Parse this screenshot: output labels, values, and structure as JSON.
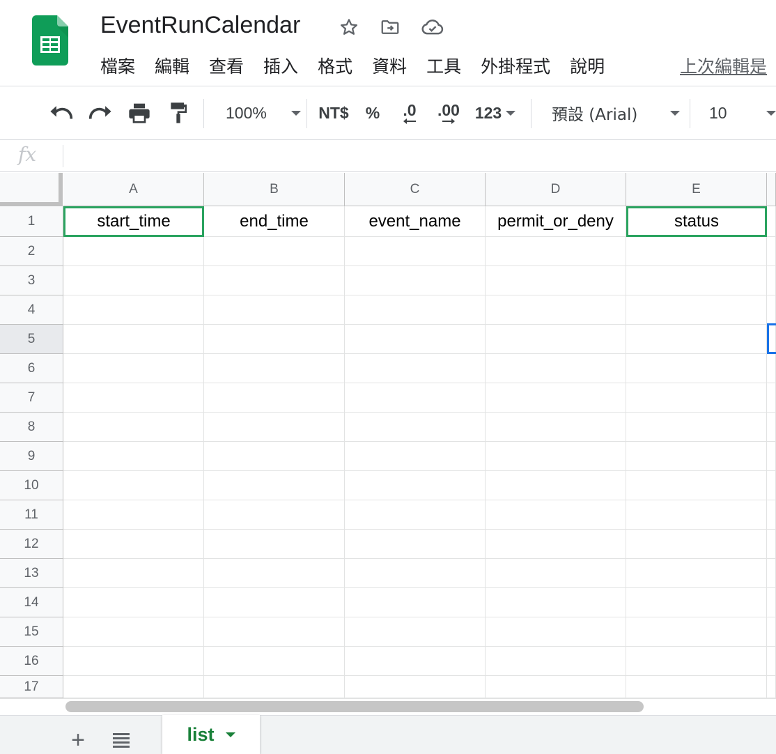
{
  "title": "EventRunCalendar",
  "menu": [
    "檔案",
    "編輯",
    "查看",
    "插入",
    "格式",
    "資料",
    "工具",
    "外掛程式",
    "說明"
  ],
  "last_edit": "上次編輯是",
  "toolbar": {
    "zoom": "100%",
    "currency": "NT$",
    "percent": "%",
    "decrease_decimal": ".0",
    "increase_decimal": ".00",
    "more_formats": "123",
    "font": "預設 (Arial)",
    "font_size": "10"
  },
  "formula_bar": {
    "fx": "fx",
    "value": ""
  },
  "columns": [
    "A",
    "B",
    "C",
    "D",
    "E"
  ],
  "rows": [
    "1",
    "2",
    "3",
    "4",
    "5",
    "6",
    "7",
    "8",
    "9",
    "10",
    "11",
    "12",
    "13",
    "14",
    "15",
    "16",
    "17"
  ],
  "cells": [
    [
      "start_time",
      "end_time",
      "event_name",
      "permit_or_deny",
      "status"
    ]
  ],
  "selection": {
    "active_row": "5",
    "highlighted": [
      "A1",
      "E1"
    ]
  },
  "sheets": [
    {
      "name": "list",
      "active": true
    }
  ],
  "colors": {
    "sheets_green": "#0f9d58",
    "tab_label": "#188038",
    "selection_green": "#2aa35f",
    "active_blue": "#1a73e8"
  },
  "icons": [
    "sheets-logo-icon",
    "star-icon",
    "move-to-folder-icon",
    "cloud-saved-icon",
    "undo-icon",
    "redo-icon",
    "print-icon",
    "paint-format-icon",
    "add-sheet-icon",
    "all-sheets-icon"
  ]
}
